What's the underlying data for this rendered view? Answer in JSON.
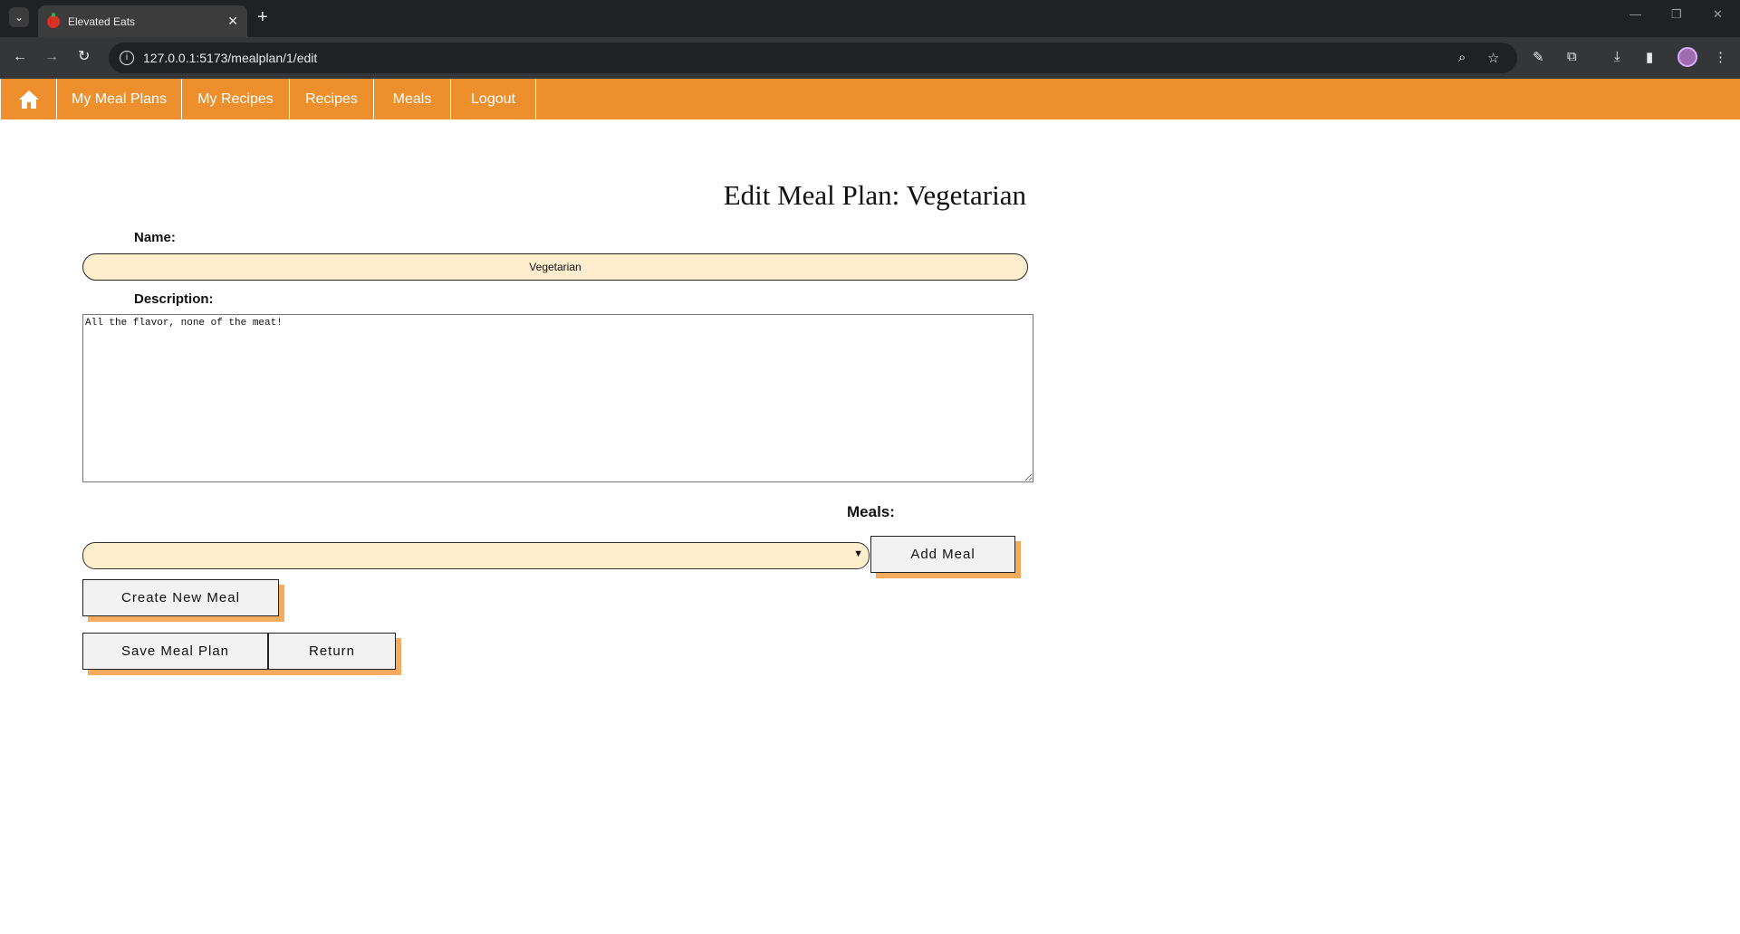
{
  "browser": {
    "tab_title": "Elevated Eats",
    "tab_close": "✕",
    "new_tab": "+",
    "url": "127.0.0.1:5173/mealplan/1/edit",
    "window_controls": [
      "—",
      "❐",
      "✕"
    ]
  },
  "nav": {
    "home_icon": "home-icon",
    "items": [
      "My Meal Plans",
      "My Recipes",
      "Recipes",
      "Meals",
      "Logout"
    ]
  },
  "page": {
    "title": "Edit Meal Plan: Vegetarian",
    "name_label": "Name:",
    "name_value": "Vegetarian",
    "description_label": "Description:",
    "description_value": "All the flavor, none of the meat!",
    "meals_label": "Meals:",
    "meal_select_value": "",
    "add_meal_label": "Add Meal",
    "create_meal_label": "Create New Meal",
    "save_label": "Save Meal Plan",
    "return_label": "Return"
  },
  "colors": {
    "nav_bg": "#ec8f2c",
    "input_bg": "#feeecd",
    "button_shadow": "#f4ab5f"
  }
}
